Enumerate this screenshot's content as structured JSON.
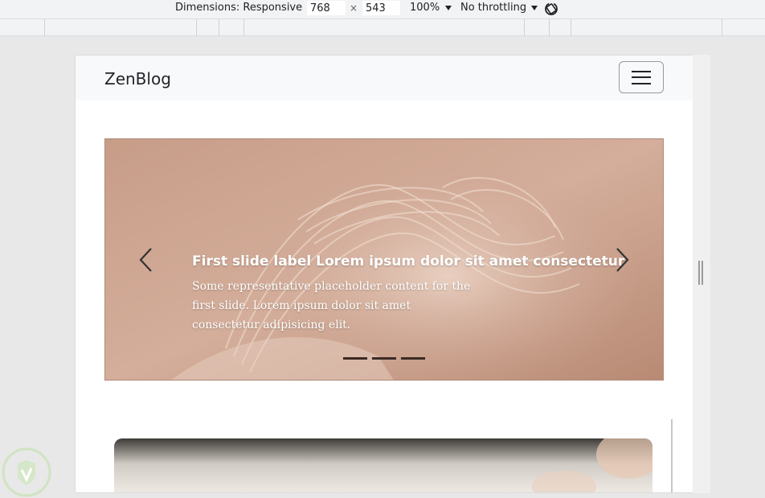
{
  "devtools": {
    "dimensions_label": "Dimensions: Responsive",
    "width_value": "768",
    "height_value": "543",
    "times_symbol": "×",
    "zoom": "100%",
    "throttling": "No throttling"
  },
  "site": {
    "brand": "ZenBlog"
  },
  "carousel": {
    "slide_title": "First slide label Lorem ipsum dolor sit amet consectetur",
    "slide_text": "Some representative placeholder content for the first slide. Lorem ipsum dolor sit amet consectetur adipisicing elit.",
    "indicator_count": 3,
    "active_indicator": 0
  },
  "colors": {
    "slide_bg": "#c9a08b",
    "navbar_bg": "#f8f9fa"
  }
}
